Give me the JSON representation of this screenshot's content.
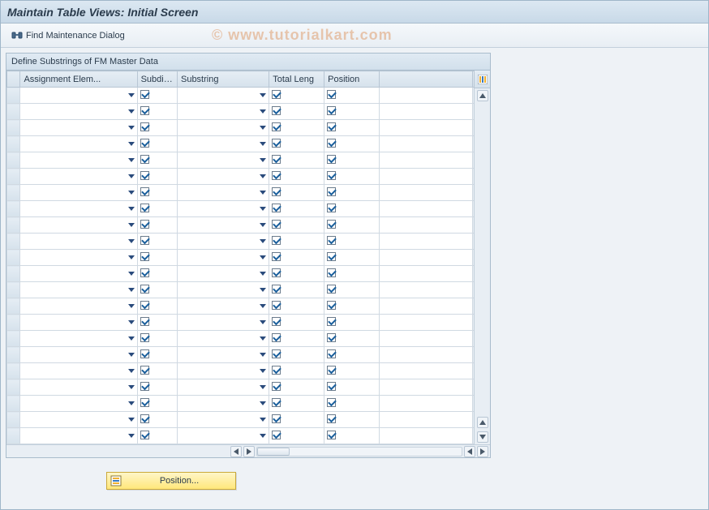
{
  "header": {
    "title": "Maintain Table Views: Initial Screen"
  },
  "toolbar": {
    "find_label": "Find Maintenance Dialog"
  },
  "watermark": "© www.tutorialkart.com",
  "panel": {
    "title": "Define Substrings of FM Master Data"
  },
  "columns": {
    "assignment": "Assignment Elem...",
    "subdiv": "Subdiv. ID",
    "substring": "Substring",
    "total_leng": "Total Leng",
    "position": "Position"
  },
  "row_count": 22,
  "position_button": {
    "label": "Position..."
  }
}
